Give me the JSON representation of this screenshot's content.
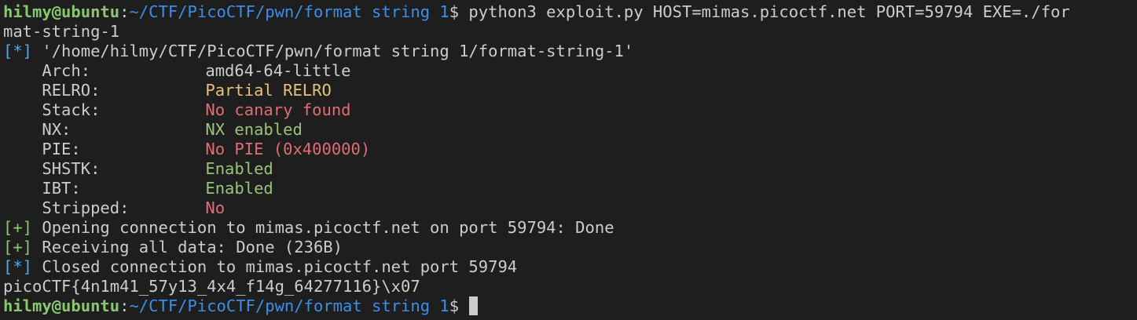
{
  "prompt": {
    "user_host": "hilmy@ubuntu",
    "sep": ":",
    "path": "~/CTF/PicoCTF/pwn/format string 1",
    "symbol": "$"
  },
  "command": {
    "text_line1": " python3 exploit.py HOST=mimas.picoctf.net PORT=59794 EXE=./for",
    "text_line2": "mat-string-1"
  },
  "checksec": {
    "marker": "[*]",
    "file": " '/home/hilmy/CTF/PicoCTF/pwn/format string 1/format-string-1'",
    "rows": [
      {
        "label": "Arch:",
        "value": "amd64-64-little"
      },
      {
        "label": "RELRO:",
        "value": "Partial RELRO"
      },
      {
        "label": "Stack:",
        "value": "No canary found"
      },
      {
        "label": "NX:",
        "value": "NX enabled"
      },
      {
        "label": "PIE:",
        "value": "No PIE (0x400000)"
      },
      {
        "label": "SHSTK:",
        "value": "Enabled"
      },
      {
        "label": "IBT:",
        "value": "Enabled"
      },
      {
        "label": "Stripped:",
        "value": "No"
      }
    ]
  },
  "log": [
    {
      "marker": "[+]",
      "text": " Opening connection to mimas.picoctf.net on port 59794: Done"
    },
    {
      "marker": "[+]",
      "text": " Receiving all data: Done (236B)"
    },
    {
      "marker": "[*]",
      "text": " Closed connection to mimas.picoctf.net port 59794"
    }
  ],
  "flag_output": "picoCTF{4n1m41_57y13_4x4_f14g_64277116}\\x07",
  "colors": {
    "background": "#1e1e1e",
    "prompt_user": "#8ac770",
    "prompt_path": "#3b8eea",
    "warn": "#e5c07b",
    "bad": "#e06c75",
    "good": "#98c379"
  }
}
